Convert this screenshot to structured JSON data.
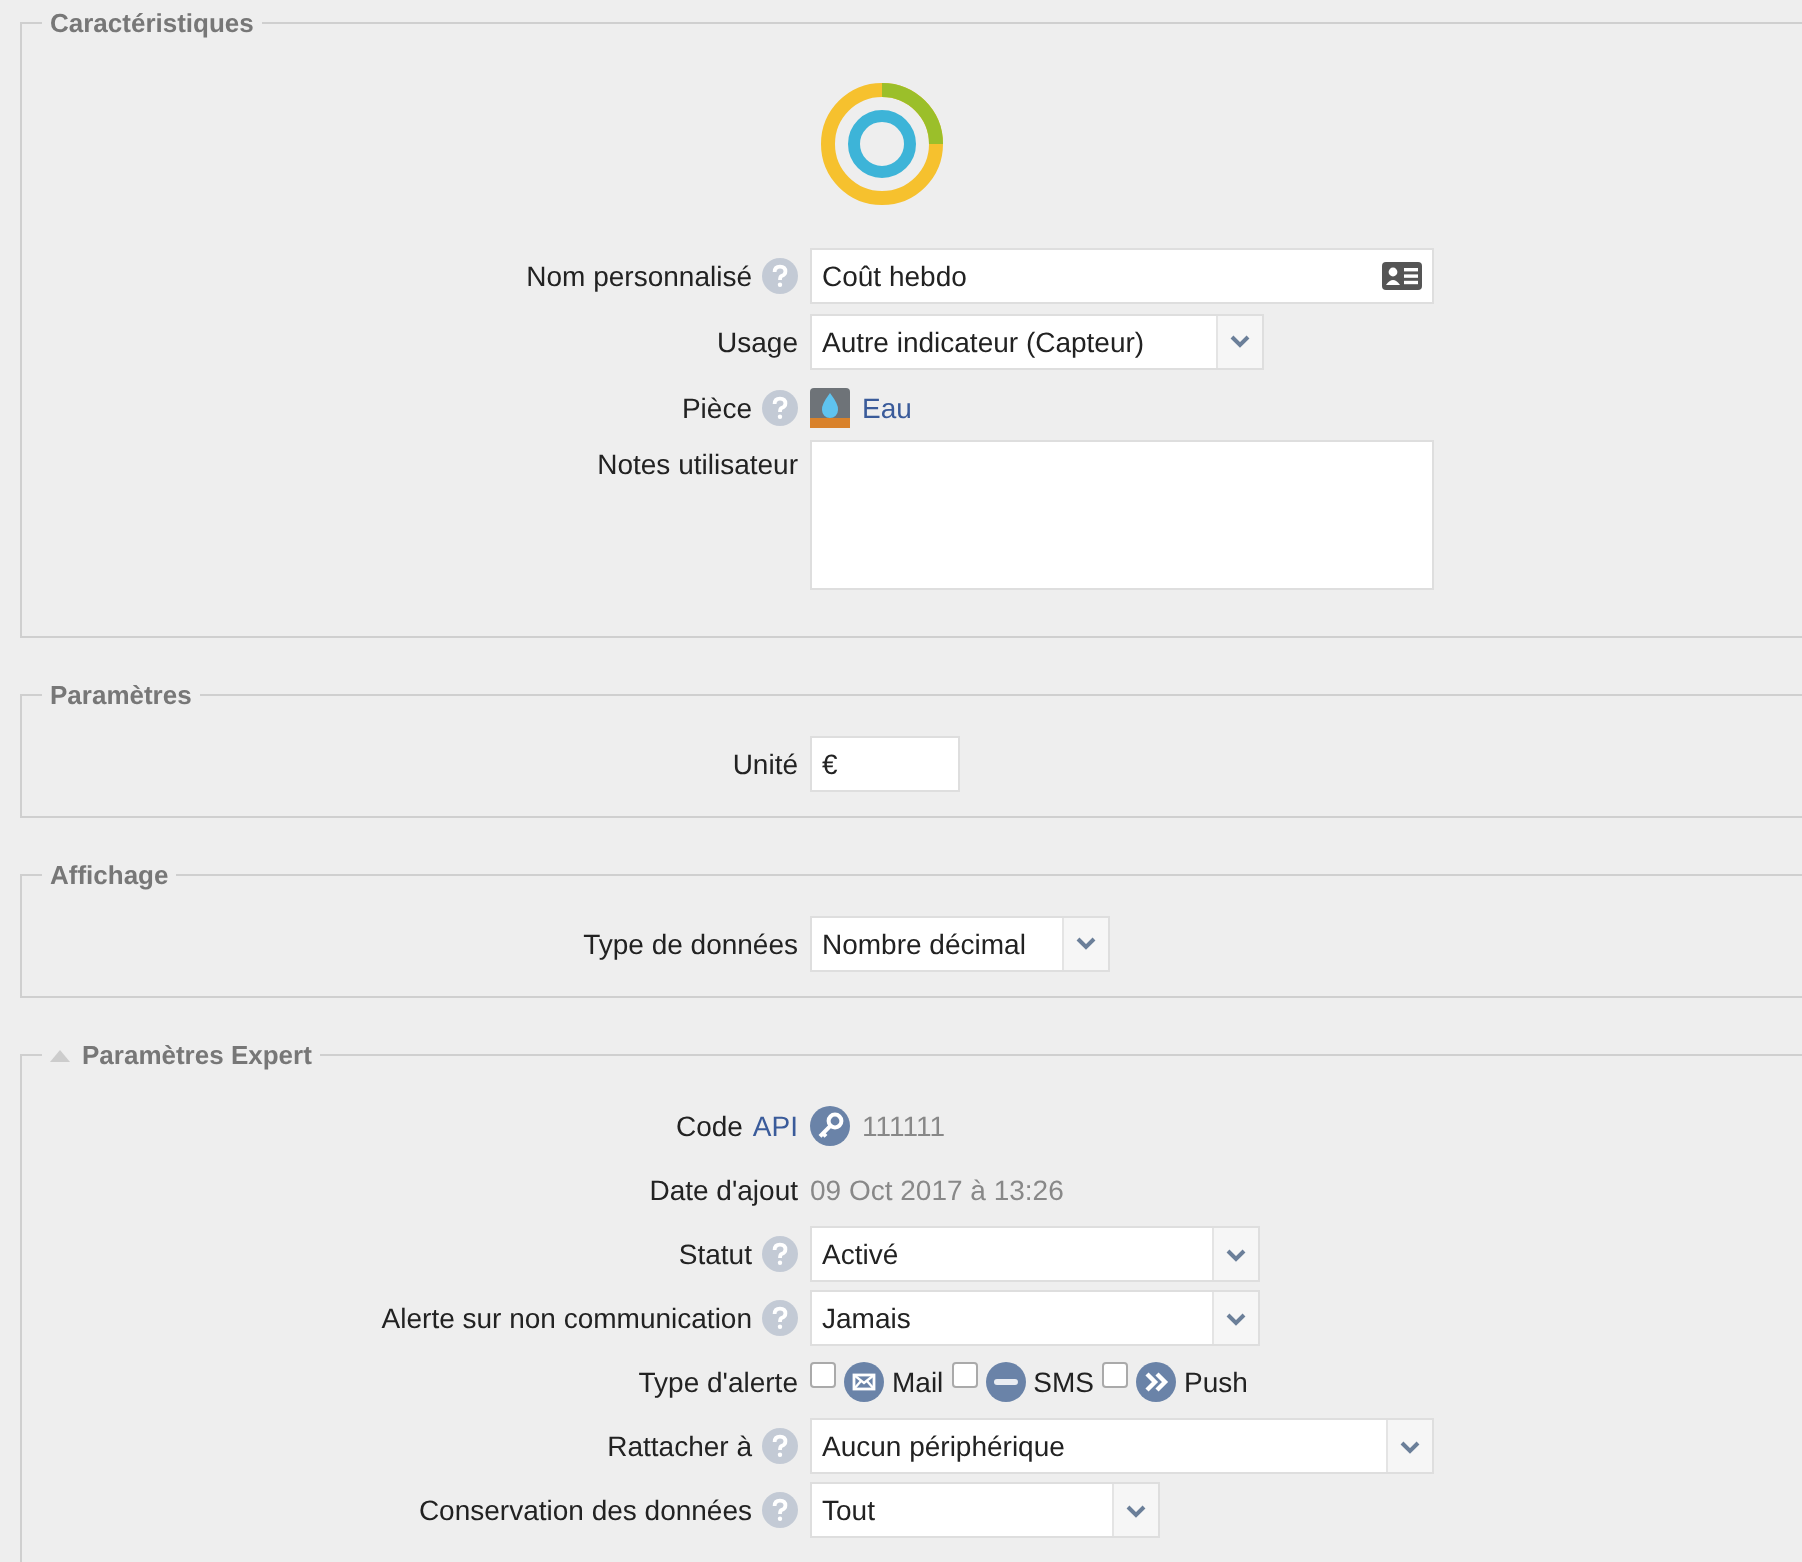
{
  "sections": [
    {
      "title": "Caractéristiques",
      "rows": [
        {
          "kind": "text",
          "label": "Nom personnalisé",
          "help": true,
          "value": "Coût hebdo"
        },
        {
          "kind": "select",
          "label": "Usage",
          "help": false,
          "value": "Autre indicateur (Capteur)"
        },
        {
          "kind": "link",
          "label": "Pièce",
          "help": true,
          "value": "Eau"
        },
        {
          "kind": "textarea",
          "label": "Notes utilisateur",
          "help": false
        }
      ]
    },
    {
      "title": "Paramètres",
      "rows": [
        {
          "kind": "short",
          "label": "Unité",
          "help": false,
          "value": "€"
        }
      ]
    },
    {
      "title": "Affichage",
      "rows": [
        {
          "kind": "select",
          "label": "Type de données",
          "help": false,
          "value": "Nombre décimal"
        }
      ]
    },
    {
      "title": "Paramètres Expert",
      "expanded": true,
      "rows": [
        {
          "kind": "api",
          "label": "Code",
          "link": "API",
          "help": false,
          "value": "111111"
        },
        {
          "kind": "static",
          "label": "Date d'ajout",
          "help": false,
          "value": "09 Oct 2017 à 13:26"
        },
        {
          "kind": "select",
          "label": "Statut",
          "help": true,
          "value": "Activé"
        },
        {
          "kind": "select",
          "label": "Alerte sur non communication",
          "help": true,
          "value": "Jamais"
        },
        {
          "kind": "checks",
          "label": "Type d'alerte",
          "help": false,
          "options": [
            {
              "label": "Mail",
              "checked": false
            },
            {
              "label": "SMS",
              "checked": false
            },
            {
              "label": "Push",
              "checked": false
            }
          ]
        },
        {
          "kind": "select",
          "label": "Rattacher à",
          "help": true,
          "value": "Aucun périphérique"
        },
        {
          "kind": "select",
          "label": "Conservation des données",
          "help": true,
          "value": "Tout"
        }
      ]
    }
  ]
}
